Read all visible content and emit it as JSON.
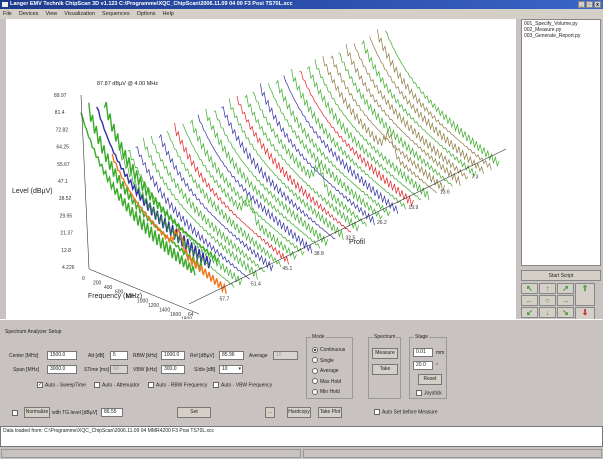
{
  "window": {
    "title": "Langer EMV Technik ChipScan 3D v1.123   C:\\Programme\\XQC_ChipScan\\2006.11.09  04    00 F3 Posi TS70L.xcc",
    "controls": [
      "_",
      "▫",
      "x"
    ]
  },
  "menu": [
    "File",
    "Devices",
    "View",
    "Visualization",
    "Sequences",
    "Options",
    "Help"
  ],
  "plot": {
    "annotation": "87.87 dBµV @ 4.00 MHz",
    "level_label": "Level (dBµV)",
    "level_ticks": [
      "89.97",
      "81.4",
      "72.82",
      "64.25",
      "55.67",
      "47.1",
      "38.52",
      "29.95",
      "21.37",
      "12.8",
      "4.226"
    ],
    "freq_label": "Frequency (MHz)",
    "freq_ticks": [
      "0",
      "200",
      "400",
      "600",
      "800",
      "1000",
      "1200",
      "1400",
      "1600",
      "1800",
      "2000"
    ],
    "profil_label": "Profil",
    "profil_ticks": [
      "64",
      "57.7",
      "51.4",
      "45.1",
      "38.8",
      "32.5",
      "26.2",
      "19.9",
      "13.6",
      "7.3"
    ],
    "colors": {
      "green": "#3aaa2a",
      "orange": "#f07820",
      "blue": "#3030a0",
      "red": "#e02020",
      "olive": "#8a7a40"
    }
  },
  "scripts": {
    "items": [
      "001_Specify_Volume.py",
      "002_Measure.py",
      "003_Generate_Report.py"
    ],
    "start_label": "Start Script"
  },
  "stage_arrows": [
    "↖",
    "↑",
    "↗",
    "←",
    "○",
    "→",
    "↙",
    "↓",
    "↘",
    "⇑",
    "⇓",
    "↶",
    "↷"
  ],
  "setup": {
    "title": "Spectrum Analyzer Setup",
    "center_label": "Center [MHz]",
    "center": "1500.0",
    "att_label": "Att [dB]",
    "att": "5",
    "rbw_label": "RBW [kHz]",
    "rbw": "1000.0",
    "ref_label": "Ref [dBµV]",
    "ref": "85.96",
    "average_label": "Average",
    "average": "10",
    "span_label": "Span [MHz]",
    "span": "3000.0",
    "stime_label": "STime [ms]",
    "stime": "60",
    "vbw_label": "VBW [kHz]",
    "vbw": "300.0",
    "sdiv_label": "S/div [dB]",
    "sdiv": "10",
    "auto": [
      {
        "label": "Auto - SweepTime",
        "checked": true
      },
      {
        "label": "Auto - Attenuator",
        "checked": false
      },
      {
        "label": "Auto - RBW Frequency",
        "checked": false
      },
      {
        "label": "Auto - VBW Frequency",
        "checked": false
      }
    ],
    "normalize_label": "Normalize",
    "tg_label": "with TG level [dBµV]",
    "tg": "86.55",
    "set_label": "Set",
    "dots_label": "...",
    "hardcopy_label": "Hardcopy",
    "takeplot_label": "Take Plot"
  },
  "mode": {
    "title": "Mode",
    "options": [
      "Continuous",
      "Single",
      "Average",
      "Max Hold",
      "Min Hold"
    ],
    "selected": 0
  },
  "spectrum": {
    "title": "Spectrum",
    "measure_label": "Measure",
    "take_label": "Take"
  },
  "stage": {
    "title": "Stage",
    "step": "0.01",
    "step_unit": "mm",
    "angle": "20.0",
    "angle_unit": "°",
    "reset_label": "Reset",
    "joystick_label": "Joystick"
  },
  "autoset_label": "Auto Set before Measure",
  "log": "Data loaded from: C:\\Programme\\XQC_ChipScan\\2006.11.09 04 MMR4200 F3 Posi TS70L.xcc"
}
